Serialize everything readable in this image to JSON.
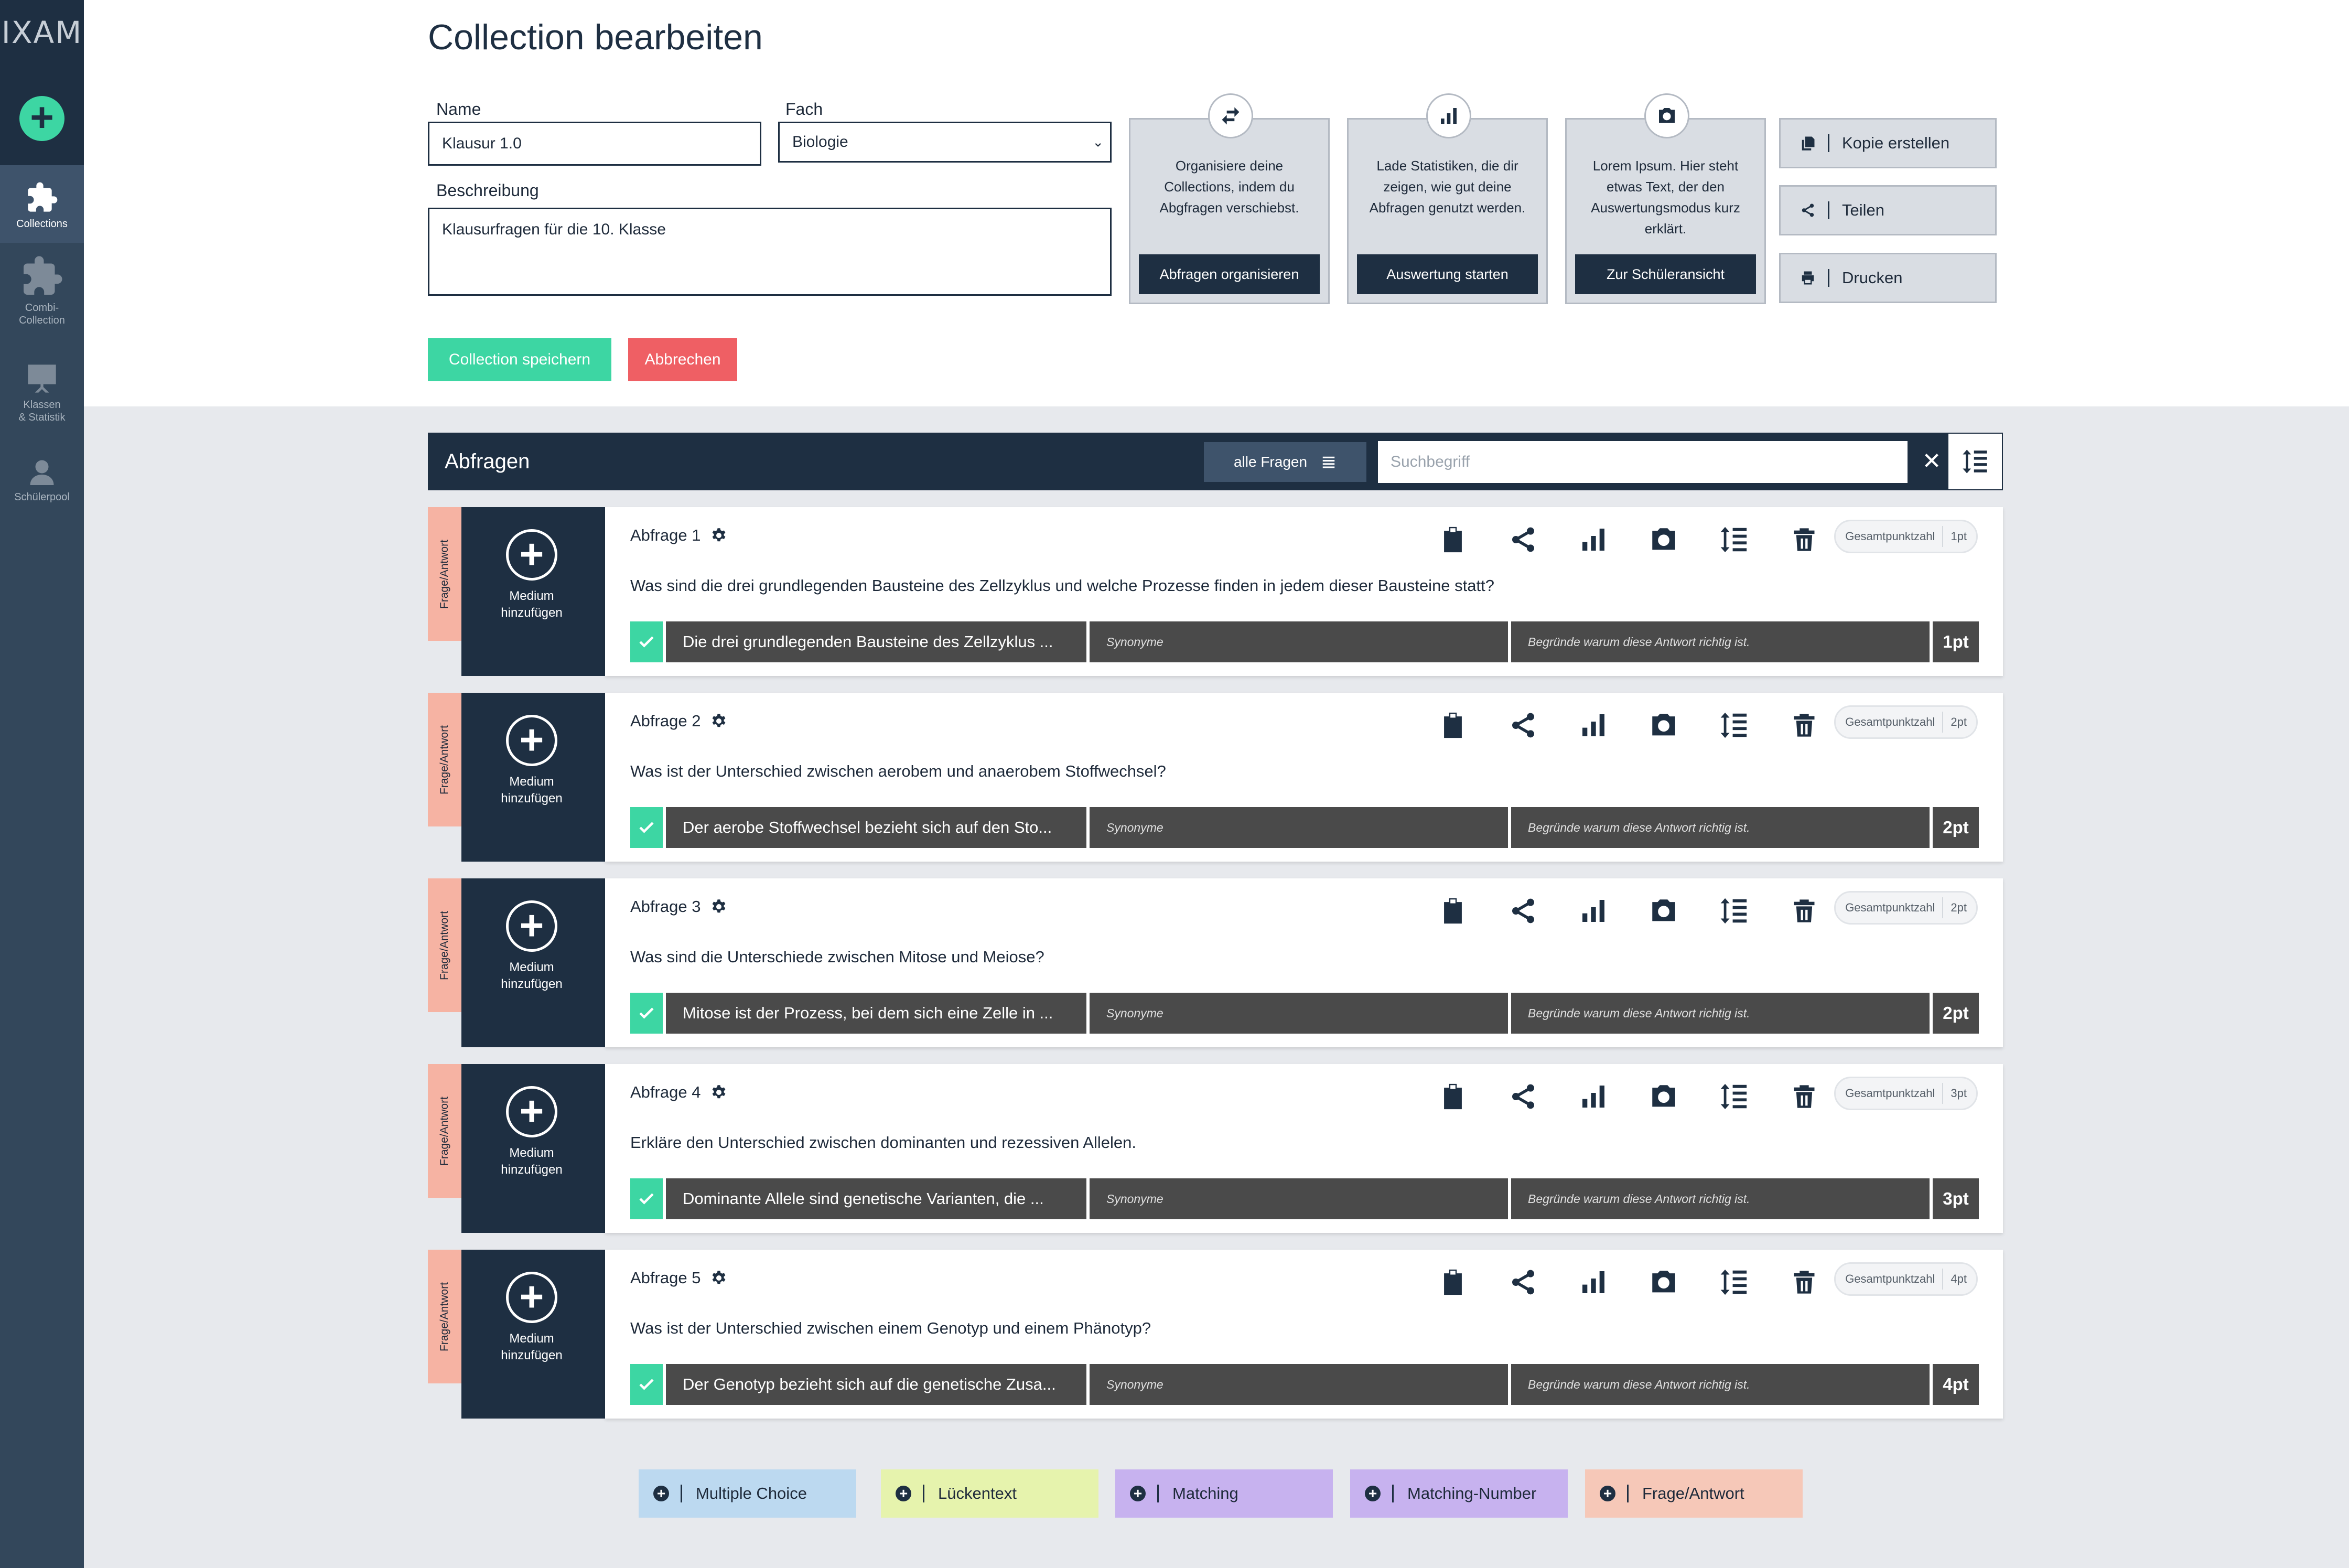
{
  "sidebar": {
    "logo": "IXAM",
    "items": [
      {
        "label_line1": "Collections",
        "label_line2": ""
      },
      {
        "label_line1": "Combi-",
        "label_line2": "Collection"
      },
      {
        "label_line1": "Klassen",
        "label_line2": "& Statistik"
      },
      {
        "label_line1": "Schülerpool",
        "label_line2": ""
      }
    ]
  },
  "page": {
    "title": "Collection bearbeiten"
  },
  "form": {
    "name_label": "Name",
    "name_value": "Klausur 1.0",
    "fach_label": "Fach",
    "fach_value": "Biologie",
    "beschreibung_label": "Beschreibung",
    "beschreibung_value": "Klausurfragen für die 10. Klasse",
    "save_label": "Collection speichern",
    "cancel_label": "Abbrechen"
  },
  "cards": [
    {
      "icon": "swap-icon",
      "text": "Organisiere deine Collections, indem du Abgfragen verschiebst.",
      "button": "Abfragen organisieren"
    },
    {
      "icon": "bar-chart-icon",
      "text": "Lade Statistiken, die dir zeigen, wie gut deine Abfragen genutzt werden.",
      "button": "Auswertung starten"
    },
    {
      "icon": "camera-icon",
      "text": "Lorem Ipsum. Hier steht etwas Text, der den Auswertungsmodus kurz erklärt.",
      "button": "Zur Schüleransicht"
    }
  ],
  "actions": [
    {
      "icon": "copy-icon",
      "label": "Kopie erstellen"
    },
    {
      "icon": "share-icon",
      "label": "Teilen"
    },
    {
      "icon": "print-icon",
      "label": "Drucken"
    }
  ],
  "abfragen": {
    "title": "Abfragen",
    "filter_label": "alle Fragen",
    "search_placeholder": "Suchbegriff",
    "clear_label": "✕"
  },
  "questions": [
    {
      "tag": "Frage/Antwort",
      "medium": "Medium",
      "medium2": "hinzufügen",
      "title": "Abfrage 1",
      "pill_label": "Gesamtpunktzahl",
      "pill_points": "1pt",
      "text": "Was sind die drei grundlegenden Bausteine des Zellzyklus und welche Prozesse finden in jedem dieser Bausteine statt?",
      "answer": "Die drei grundlegenden Bausteine des Zellzyklus ...",
      "synonyme": "Synonyme",
      "reason": "Begründe warum diese Antwort richtig ist.",
      "points": "1pt"
    },
    {
      "tag": "Frage/Antwort",
      "medium": "Medium",
      "medium2": "hinzufügen",
      "title": "Abfrage 2",
      "pill_label": "Gesamtpunktzahl",
      "pill_points": "2pt",
      "text": "Was ist der Unterschied zwischen aerobem und anaerobem Stoffwechsel?",
      "answer": "Der aerobe Stoffwechsel bezieht sich auf den Sto...",
      "synonyme": "Synonyme",
      "reason": "Begründe warum diese Antwort richtig ist.",
      "points": "2pt"
    },
    {
      "tag": "Frage/Antwort",
      "medium": "Medium",
      "medium2": "hinzufügen",
      "title": "Abfrage 3",
      "pill_label": "Gesamtpunktzahl",
      "pill_points": "2pt",
      "text": "Was sind die Unterschiede zwischen Mitose und Meiose?",
      "answer": "Mitose ist der Prozess, bei dem sich eine Zelle in ...",
      "synonyme": "Synonyme",
      "reason": "Begründe warum diese Antwort richtig ist.",
      "points": "2pt"
    },
    {
      "tag": "Frage/Antwort",
      "medium": "Medium",
      "medium2": "hinzufügen",
      "title": "Abfrage 4",
      "pill_label": "Gesamtpunktzahl",
      "pill_points": "3pt",
      "text": "Erkläre den Unterschied zwischen dominanten und rezessiven Allelen.",
      "answer": "Dominante Allele sind genetische Varianten, die ...",
      "synonyme": "Synonyme",
      "reason": "Begründe warum diese Antwort richtig ist.",
      "points": "3pt"
    },
    {
      "tag": "Frage/Antwort",
      "medium": "Medium",
      "medium2": "hinzufügen",
      "title": "Abfrage 5",
      "pill_label": "Gesamtpunktzahl",
      "pill_points": "4pt",
      "text": "Was ist der Unterschied zwischen einem Genotyp und einem Phänotyp?",
      "answer": "Der Genotyp bezieht sich auf die genetische Zusa...",
      "synonyme": "Synonyme",
      "reason": "Begründe warum diese Antwort richtig ist.",
      "points": "4pt"
    }
  ],
  "question_icons": [
    "clipboard-icon",
    "share-icon",
    "bar-chart-icon",
    "camera-icon",
    "list-order-icon",
    "trash-icon"
  ],
  "add_types": [
    {
      "label": "Multiple Choice",
      "color": "#bcd9f0"
    },
    {
      "label": "Lückentext",
      "color": "#e6f3ad"
    },
    {
      "label": "Matching",
      "color": "#c7b2ef"
    },
    {
      "label": "Matching-Number",
      "color": "#c7b2ef"
    },
    {
      "label": "Frage/Antwort",
      "color": "#f6c8b8"
    }
  ],
  "colors": {
    "navy": "#1e2f42",
    "accent_green": "#3dd6a3",
    "cancel_red": "#ef5f64",
    "tag_salmon": "#f6b3a3"
  }
}
